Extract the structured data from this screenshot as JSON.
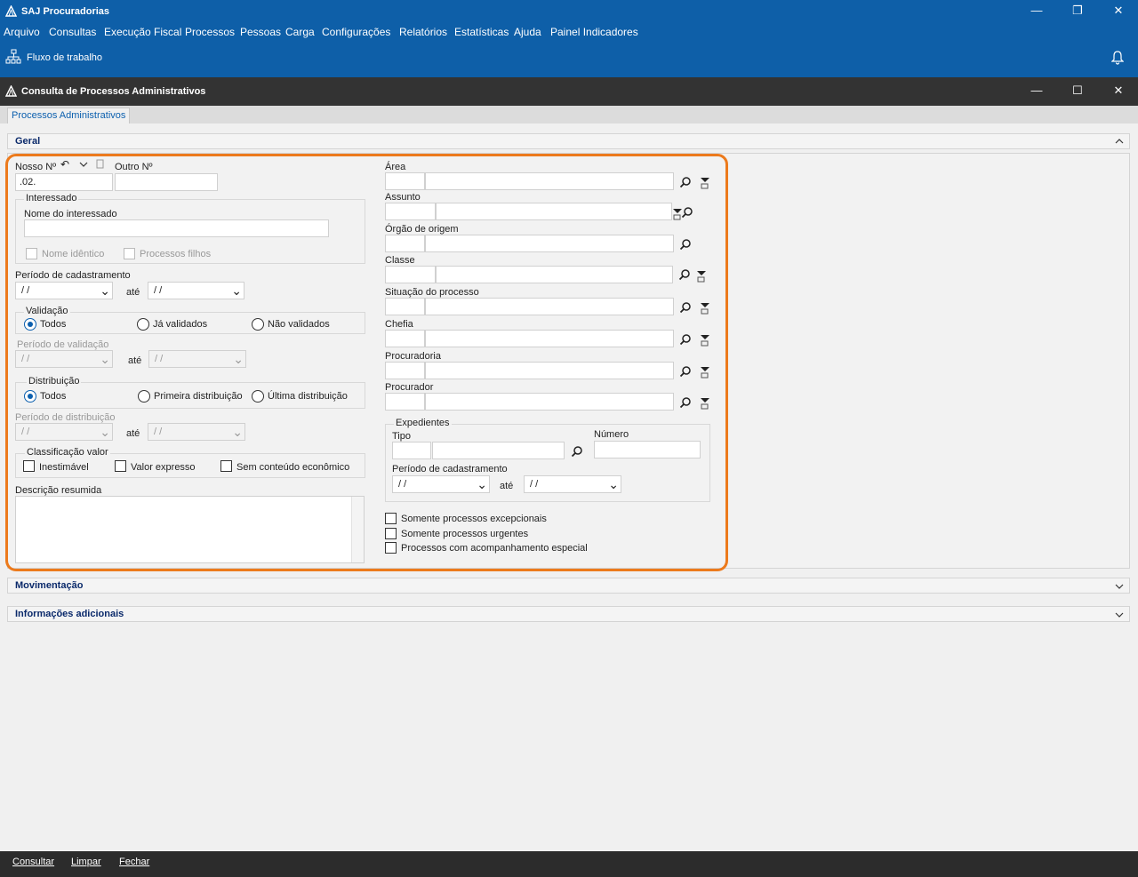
{
  "app": {
    "title": "SAJ Procuradorias"
  },
  "menu": [
    "Arquivo",
    "Consultas",
    "Execução Fiscal",
    "Processos",
    "Pessoas",
    "Carga",
    "Configurações",
    "Relatórios",
    "Estatísticas",
    "Ajuda",
    "Painel Indicadores"
  ],
  "toolbar": {
    "workflow_label": "Fluxo de trabalho"
  },
  "window": {
    "title": "Consulta de Processos Administrativos",
    "tab": "Processos Administrativos"
  },
  "sections": {
    "geral": "Geral",
    "movimentacao": "Movimentação",
    "info": "Informações adicionais"
  },
  "left": {
    "nosso_no_label": "Nosso Nº",
    "nosso_no_value": ".02.",
    "outro_no_label": "Outro Nº",
    "interessado_group": "Interessado",
    "nome_interessado_label": "Nome do interessado",
    "nome_identico": "Nome idêntico",
    "processos_filhos": "Processos filhos",
    "periodo_cadastramento": "Período de cadastramento",
    "date_placeholder": "/ /",
    "ate": "até",
    "validacao_group": "Validação",
    "validacao_options": [
      "Todos",
      "Já validados",
      "Não validados"
    ],
    "periodo_validacao": "Período de validação",
    "distribuicao_group": "Distribuição",
    "distribuicao_options": [
      "Todos",
      "Primeira distribuição",
      "Última distribuição"
    ],
    "periodo_distribuicao": "Período de distribuição",
    "classificacao_group": "Classificação valor",
    "classificacao_options": [
      "Inestimável",
      "Valor expresso",
      "Sem conteúdo econômico"
    ],
    "descricao_resumida": "Descrição resumida"
  },
  "right": {
    "area": "Área",
    "assunto": "Assunto",
    "orgao": "Órgão de origem",
    "classe": "Classe",
    "situacao": "Situação do processo",
    "chefia": "Chefia",
    "procuradoria": "Procuradoria",
    "procurador": "Procurador",
    "expedientes_group": "Expedientes",
    "tipo": "Tipo",
    "numero": "Número",
    "periodo_cadastramento": "Período de cadastramento",
    "checks": [
      "Somente processos excepcionais",
      "Somente processos urgentes",
      "Processos com acompanhamento especial"
    ]
  },
  "footer": {
    "consultar": "Consultar",
    "limpar": "Limpar",
    "fechar": "Fechar"
  },
  "colors": {
    "titlebar": "#0e5fa8",
    "subtitle": "#333333",
    "highlight": "#ec7a1c",
    "footer": "#2c2c2c"
  }
}
